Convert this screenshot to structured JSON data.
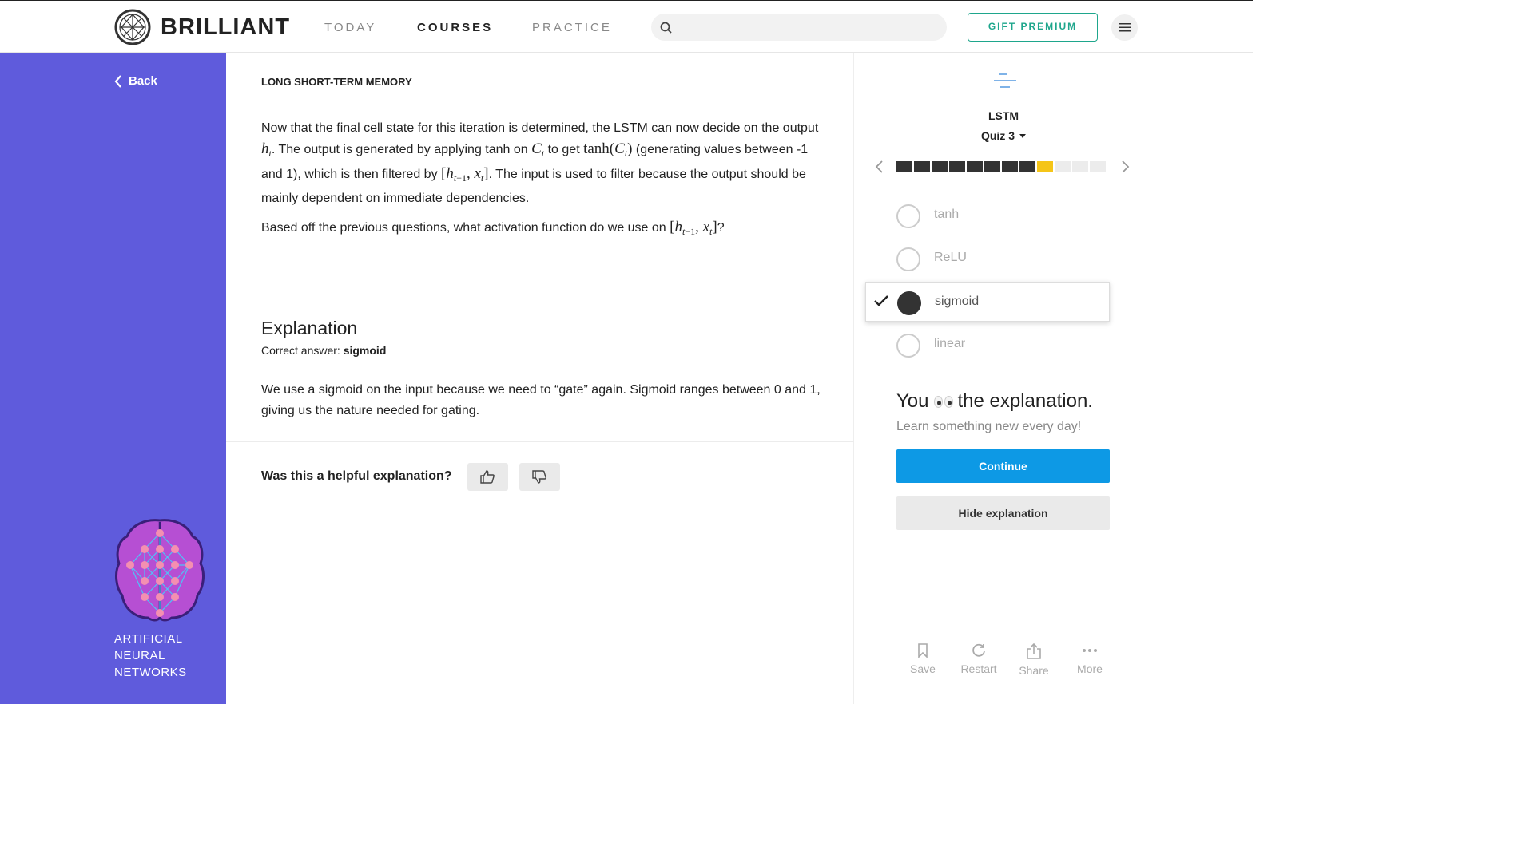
{
  "header": {
    "brand": "BRILLIANT",
    "nav": [
      "TODAY",
      "COURSES",
      "PRACTICE"
    ],
    "active_nav": "COURSES",
    "search_placeholder": "",
    "gift_label": "GIFT PREMIUM"
  },
  "sidebar": {
    "back_label": "Back",
    "course_title": "ARTIFICIAL NEURAL NETWORKS"
  },
  "main": {
    "chapter": "LONG SHORT-TERM MEMORY",
    "p1_a": "Now that the final cell state for this iteration is determined, the LSTM can now decide on the output ",
    "p1_b": ". The output is generated by applying tanh on ",
    "p1_c": " to get ",
    "p1_d": " (generating values between -1 and 1), which is then filtered by ",
    "p1_e": ". The input is used to filter because the output should be mainly dependent on immediate dependencies.",
    "p2_a": "Based off the previous questions, what activation function do we use on ",
    "p2_b": "?",
    "explanation_title": "Explanation",
    "correct_prefix": "Correct answer: ",
    "correct_answer": "sigmoid",
    "explanation_text": "We use a sigmoid on the input because we need to “gate” again. Sigmoid ranges between 0 and 1, giving us the nature needed for gating.",
    "helpful_question": "Was this a helpful explanation?"
  },
  "panel": {
    "course": "LSTM",
    "quiz": "Quiz 3",
    "progress": {
      "total": 12,
      "completed": 8,
      "current": 9
    },
    "options": [
      {
        "label": "tanh",
        "selected": false
      },
      {
        "label": "ReLU",
        "selected": false
      },
      {
        "label": "sigmoid",
        "selected": true
      },
      {
        "label": "linear",
        "selected": false
      }
    ],
    "you_prefix": "You",
    "you_suffix": "the explanation.",
    "learn": "Learn something new every day!",
    "continue_label": "Continue",
    "hide_label": "Hide explanation",
    "actions": [
      "Save",
      "Restart",
      "Share",
      "More"
    ]
  },
  "colors": {
    "sidebar": "#5f5bdc",
    "accent_green": "#1ea68c",
    "continue_blue": "#0d99e5",
    "progress_current": "#f5c518"
  }
}
